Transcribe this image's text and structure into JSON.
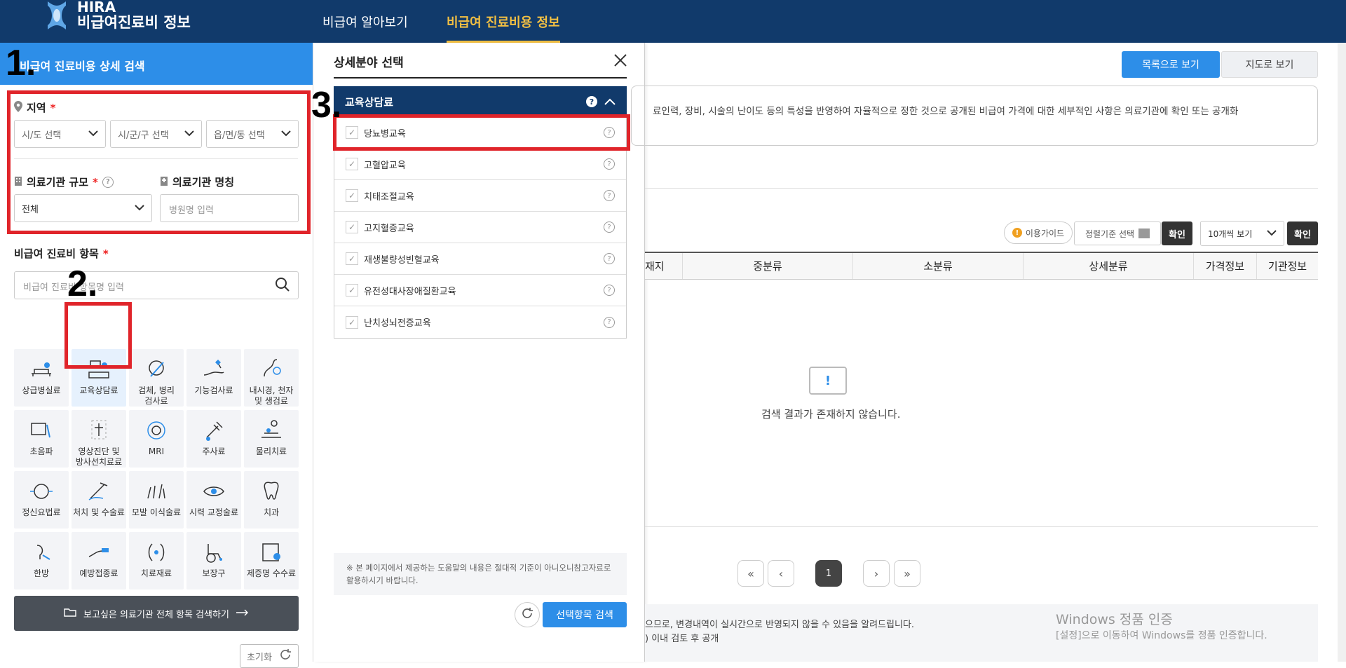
{
  "header": {
    "logo_line1": "HIRA",
    "logo_line2": "비급여진료비 정보",
    "nav": [
      "비급여 알아보기",
      "비급여 진료비용 정보"
    ]
  },
  "left_panel": {
    "title": "비급여 진료비용 상세 검색",
    "region_label": "지역",
    "sido_placeholder": "시/도 선택",
    "sigungu_placeholder": "시/군/구 선택",
    "dong_placeholder": "읍/면/동 선택",
    "scale_label": "의료기관 규모",
    "scale_value": "전체",
    "name_label": "의료기관 명칭",
    "name_placeholder": "병원명 입력",
    "items_label": "비급여 진료비 항목",
    "items_placeholder": "비급여 진료비 항목명 입력",
    "categories": [
      {
        "label": "상급병실료",
        "icon": "hospital-bed-icon"
      },
      {
        "label": "교육상담료",
        "icon": "education-consult-icon"
      },
      {
        "label": "검체, 병리\n검사료",
        "icon": "lab-test-icon"
      },
      {
        "label": "기능검사료",
        "icon": "function-test-icon"
      },
      {
        "label": "내시경, 천자\n및 생검료",
        "icon": "endoscope-icon"
      },
      {
        "label": "초음파",
        "icon": "ultrasound-icon"
      },
      {
        "label": "영상진단 및\n방사선치료료",
        "icon": "radiology-icon"
      },
      {
        "label": "MRI",
        "icon": "mri-icon"
      },
      {
        "label": "주사료",
        "icon": "injection-icon"
      },
      {
        "label": "물리치료",
        "icon": "physiotherapy-icon"
      },
      {
        "label": "정신요법료",
        "icon": "psychotherapy-icon"
      },
      {
        "label": "처치 및 수술료",
        "icon": "surgery-icon"
      },
      {
        "label": "모발 이식술료",
        "icon": "hair-transplant-icon"
      },
      {
        "label": "시력 교정술료",
        "icon": "eye-icon"
      },
      {
        "label": "치과",
        "icon": "tooth-icon"
      },
      {
        "label": "한방",
        "icon": "oriental-medicine-icon"
      },
      {
        "label": "예방접종료",
        "icon": "vaccine-icon"
      },
      {
        "label": "치료재료",
        "icon": "treatment-material-icon"
      },
      {
        "label": "보장구",
        "icon": "wheelchair-icon"
      },
      {
        "label": "제증명 수수료",
        "icon": "certificate-icon"
      }
    ],
    "search_all_label": "보고싶은 의료기관 전체 항목 검색하기",
    "reset_label": "초기화"
  },
  "annotations": [
    "1.",
    "2.",
    "3."
  ],
  "popup": {
    "title": "상세분야 선택",
    "category": "교육상담료",
    "items": [
      "당뇨병교육",
      "고혈압교육",
      "치태조절교육",
      "고지혈증교육",
      "재생불량성빈혈교육",
      "유전성대사장애질환교육",
      "난치성뇌전증교육"
    ],
    "note": "※ 본 페이지에서 제공하는 도움말의 내용은 절대적 기준이 아니오니참고자료로 활용하시기 바랍니다.",
    "search_label": "선택항목 검색"
  },
  "main": {
    "list_view": "목록으로 보기",
    "map_view": "지도로 보기",
    "info_text": "료인력, 장비, 시술의 난이도 등의 특성을 반영하여 자율적으로 정한 것으로 공개된 비급여 가격에 대한 세부적인 사항은 의료기관에 확인 또는 공개화",
    "guide_label": "이용가이드",
    "sort_label": "정렬기준 선택",
    "confirm_label": "확인",
    "perpage_label": "10개씩 보기",
    "columns": [
      "재지",
      "중분류",
      "소분류",
      "상세분류",
      "가격정보",
      "기관정보"
    ],
    "empty_text": "검색 결과가 존재하지 않습니다.",
    "current_page": "1",
    "footer_line1": "으므로, 변경내역이 실시간으로 반영되지 않을 수 있음을 알려드립니다.",
    "footer_line2": ") 이내 검토 후 공개"
  },
  "watermark": {
    "line1": "Windows 정품 인증",
    "line2": "[설정]으로 이동하여 Windows를 정품 인증합니다."
  },
  "colors": {
    "header": "#113a6b",
    "accent": "#2d8ee8",
    "highlight": "#e0242a",
    "nav_active": "#f3c043"
  }
}
